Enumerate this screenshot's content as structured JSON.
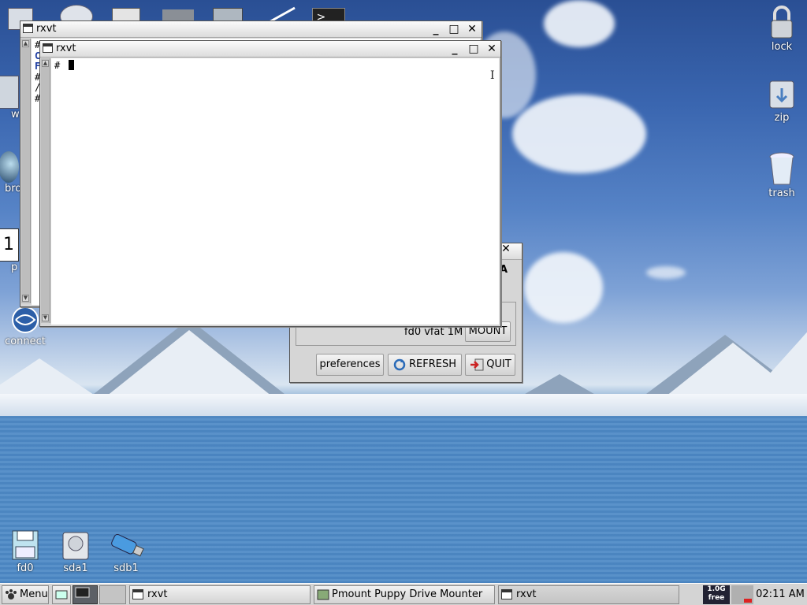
{
  "desktop": {
    "icons": {
      "lock": "lock",
      "zip": "zip",
      "trash": "trash",
      "connect": "connect",
      "fd0": "fd0",
      "sda1": "sda1",
      "sdb1": "sdb1",
      "partial_w": "w",
      "partial_bro": "bro",
      "partial_p": "p",
      "partial_1": "1"
    }
  },
  "back_terminal": {
    "title": "rxvt",
    "visible_lines": [
      "#",
      "C",
      "F",
      "#",
      "/",
      "#"
    ]
  },
  "front_terminal": {
    "title": "rxvt",
    "prompt": "#"
  },
  "pmount": {
    "partial_header": "A",
    "drive_info": "fd0 vfat 1M",
    "mount_label": "MOUNT",
    "preferences_label": "preferences",
    "refresh_label": "REFRESH",
    "quit_label": "QUIT",
    "close_glyph": "✕"
  },
  "window_controls": {
    "minimize": "_",
    "maximize": "□",
    "close": "✕"
  },
  "taskbar": {
    "menu_label": "Menu",
    "tasks": [
      {
        "label": "rxvt"
      },
      {
        "label": "Pmount Puppy Drive Mounter"
      },
      {
        "label": "rxvt"
      }
    ],
    "free_top": "1.0G",
    "free_bottom": "free",
    "clock": "02:11 AM"
  },
  "colors": {
    "taskbar_bg": "#d4d4d4",
    "titlebar": "#e8e8e8",
    "terminal_bg": "#ffffff"
  }
}
